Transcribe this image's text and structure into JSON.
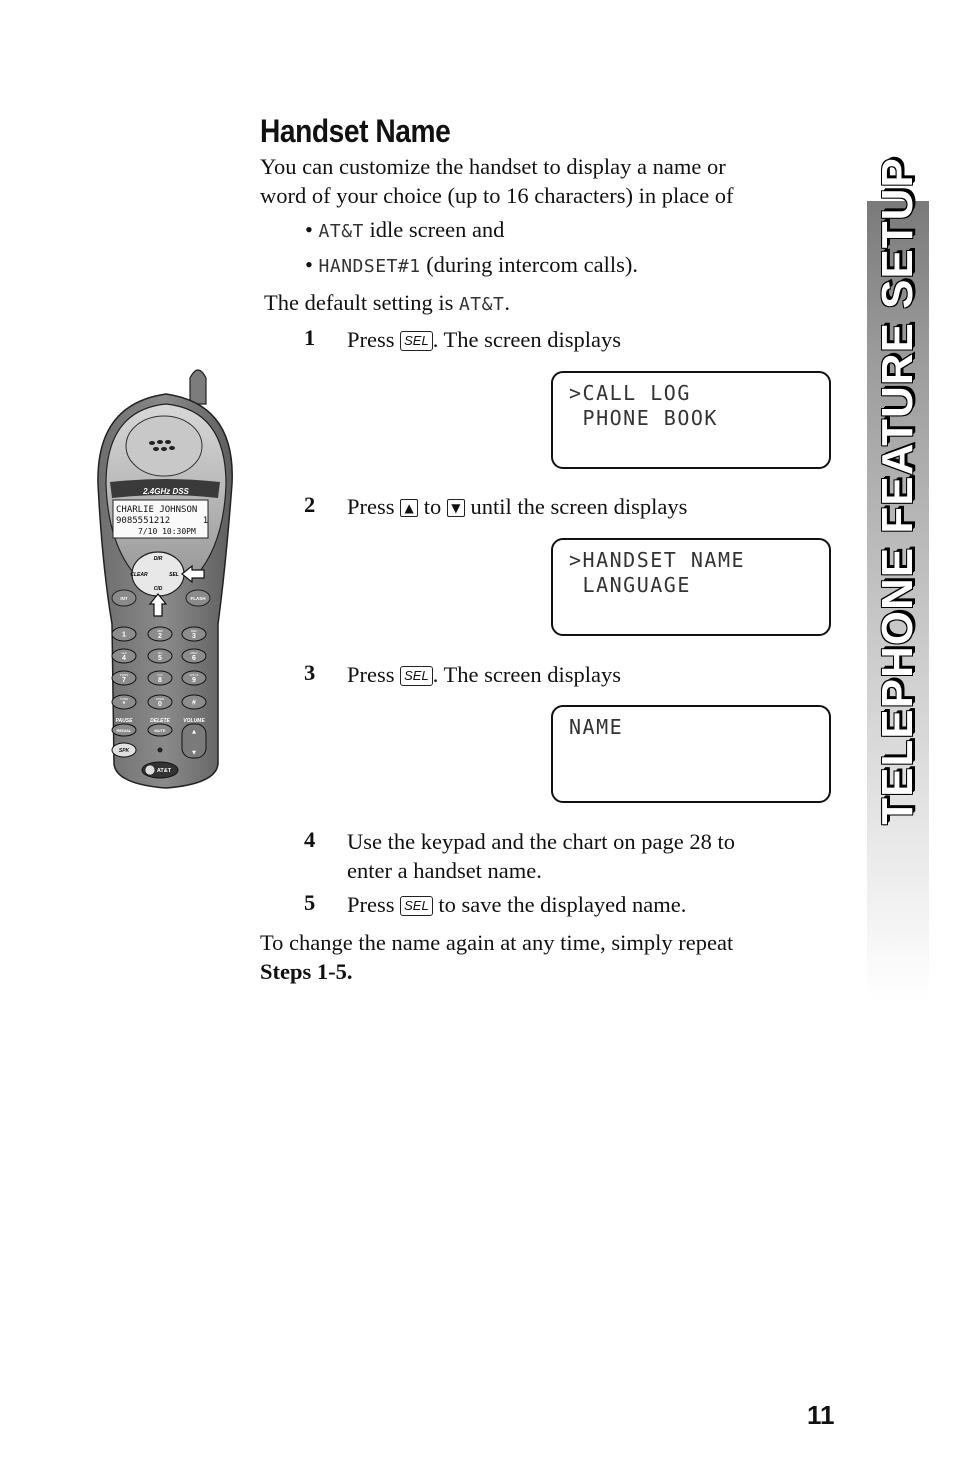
{
  "title": "Handset Name",
  "intro": {
    "line1": "You can customize the handset to display a name or",
    "line2": "word of your choice (up to 16 characters) in place of"
  },
  "bullets": [
    {
      "lcd": "AT&T",
      "text": " idle screen and"
    },
    {
      "lcd": "HANDSET#1",
      "text": " (during intercom calls)."
    }
  ],
  "default_setting": {
    "text": "The default setting is ",
    "lcd": "AT&T",
    "end": "."
  },
  "steps": [
    {
      "number": "1",
      "pre": "Press ",
      "key": "SEL",
      "post": ". The screen displays"
    },
    {
      "number": "2",
      "pre": "Press ",
      "key_up": "▲",
      "mid": " to ",
      "key_down": "▼",
      "post": " until the screen displays"
    },
    {
      "number": "3",
      "pre": "Press ",
      "key": "SEL",
      "post": ". The screen displays"
    },
    {
      "number": "4",
      "line1": "Use the keypad and the chart on page 28 to",
      "line2": "enter a handset name."
    },
    {
      "number": "5",
      "pre": "Press ",
      "key": "SEL",
      "post": " to save the displayed name."
    }
  ],
  "screens": [
    {
      "line1": ">CALL LOG",
      "line2": " PHONE BOOK"
    },
    {
      "line1": ">HANDSET NAME",
      "line2": " LANGUAGE"
    },
    {
      "line1": "NAME",
      "line2": ""
    }
  ],
  "closing": {
    "text": "To change the name again at any time, simply repeat",
    "bold": "Steps 1-5."
  },
  "side_tab": "TELEPHONE FEATURE SETUP",
  "page_number": "11",
  "phone": {
    "brand_band": "2.4GHz DSS",
    "display_line1": "CHARLIE JOHNSON",
    "display_line2": "9085551212      1",
    "display_line3": "7/10 10:30PM",
    "nav": {
      "up": "DIR",
      "left": "CLEAR",
      "right": "SEL",
      "down": "CID"
    },
    "side_buttons": {
      "left": "INT",
      "right": "FLASH"
    },
    "keys": [
      {
        "digit": "1",
        "letters": ""
      },
      {
        "digit": "2",
        "letters": "ABC"
      },
      {
        "digit": "3",
        "letters": "DEF"
      },
      {
        "digit": "4",
        "letters": "GHI"
      },
      {
        "digit": "5",
        "letters": "JKL"
      },
      {
        "digit": "6",
        "letters": "MNO"
      },
      {
        "digit": "7",
        "letters": "PQRS"
      },
      {
        "digit": "8",
        "letters": "TUV"
      },
      {
        "digit": "9",
        "letters": "WXYZ"
      },
      {
        "digit": "*",
        "letters": "TONE"
      },
      {
        "digit": "0",
        "letters": "OPER"
      },
      {
        "digit": "#",
        "letters": ""
      }
    ],
    "function_labels": {
      "pause": "PAUSE",
      "delete": "DELETE",
      "volume": "VOLUME"
    },
    "redial": "REDIAL",
    "mute": "MUTE",
    "speaker": "SPK",
    "logo": "AT&T"
  }
}
